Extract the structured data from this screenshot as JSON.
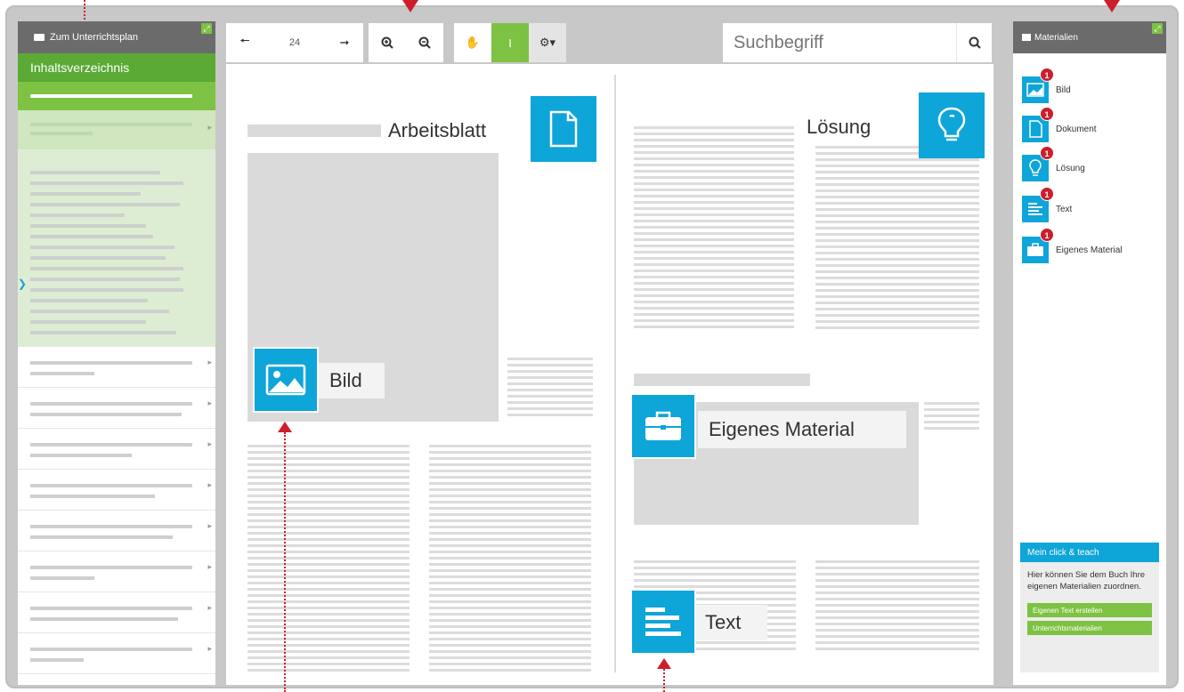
{
  "colors": {
    "accent": "#0ea5d9",
    "green": "#7dc242",
    "dark_green": "#5aaa35",
    "marker_red": "#cc1f2b",
    "header_gray": "#6b6b6b"
  },
  "sidebar": {
    "header": "Zum Unterrichtsplan",
    "toc": "Inhaltsverzeichnis"
  },
  "toolbar": {
    "page_number": "24",
    "search_placeholder": "Suchbegriff",
    "icons": [
      "arrow-left-icon",
      "arrow-right-icon",
      "zoom-in-icon",
      "zoom-out-icon",
      "hand-icon",
      "text-cursor-icon",
      "settings-icon"
    ]
  },
  "book": {
    "left_title": "Arbeitsblatt",
    "right_title": "Lösung",
    "image_label": "Bild",
    "own_material_label": "Eigenes Material",
    "text_label": "Text"
  },
  "materials": {
    "header": "Materialien",
    "items": [
      {
        "label": "Bild",
        "count": "1",
        "icon": "image-icon"
      },
      {
        "label": "Dokument",
        "count": "1",
        "icon": "document-icon"
      },
      {
        "label": "Lösung",
        "count": "1",
        "icon": "lightbulb-icon"
      },
      {
        "label": "Text",
        "count": "1",
        "icon": "text-lines-icon"
      },
      {
        "label": "Eigenes Material",
        "count": "1",
        "icon": "briefcase-icon"
      }
    ],
    "teach": {
      "title": "Mein click & teach",
      "text": "Hier können Sie dem Buch Ihre eigenen Materialien zuordnen.",
      "btn_create": "Eigenen Text erstellen",
      "btn_upload": "Unterrichtsmaterialien"
    }
  }
}
